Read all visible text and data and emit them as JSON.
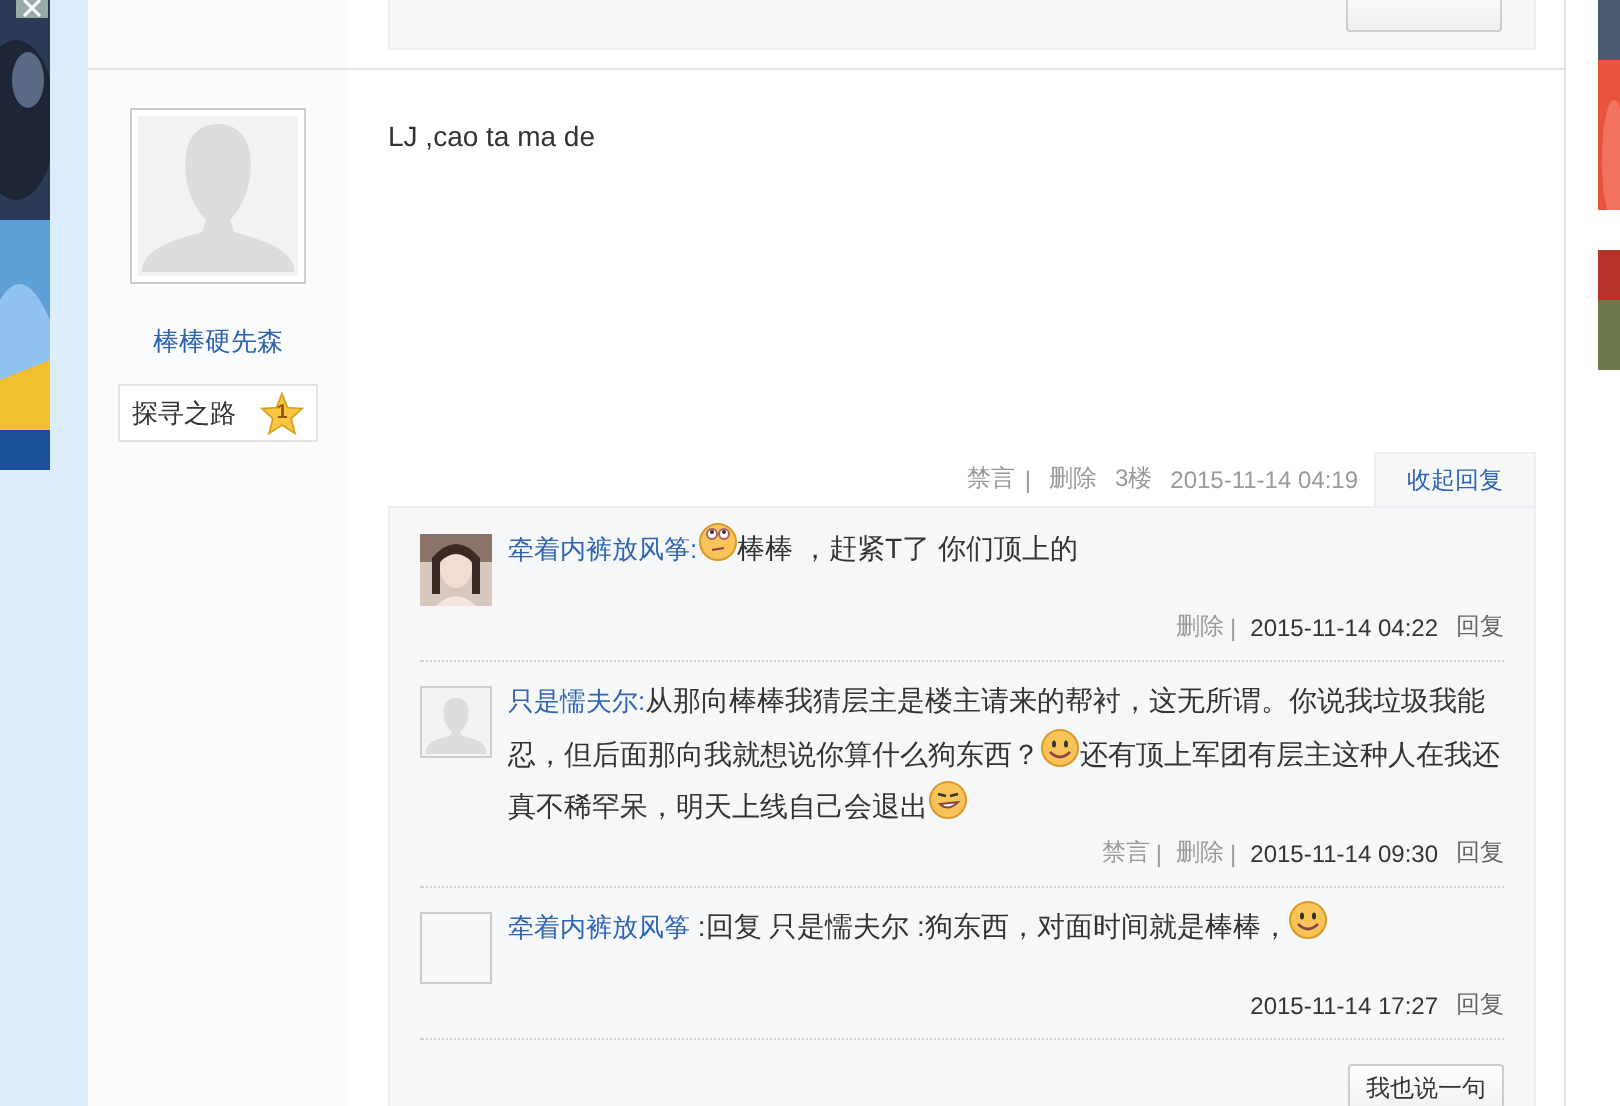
{
  "post": {
    "author": {
      "name": "棒棒硬先森",
      "badge": "探寻之路",
      "badge_level": "1"
    },
    "content": "LJ ,cao ta ma de",
    "footer": {
      "actions": [
        {
          "label": "禁言",
          "sep": "|"
        },
        {
          "label": "删除"
        }
      ],
      "floor": "3楼",
      "time": "2015-11-14 04:19",
      "toggle": "收起回复"
    },
    "replies": [
      {
        "avatar": {
          "kind": "picture"
        },
        "name": "牵着内裤放风筝:",
        "segments": [
          {
            "kind": "smirk"
          },
          {
            "kind": "text",
            "text": "棒棒 ，赶紧T了 你们顶上的"
          }
        ],
        "actions": [
          {
            "label": "删除",
            "sep": "|"
          }
        ],
        "time": "2015-11-14 04:22",
        "reply": "回复"
      },
      {
        "avatar": {
          "kind": "silhouette"
        },
        "name": "只是懦夫尔:",
        "segments": [
          {
            "kind": "text",
            "text": "从那向棒棒我猜层主是楼主请来的帮衬，这无所谓。你说我垃圾我能忍，但后面那向我就想说你算什么狗东西？"
          },
          {
            "kind": "smile"
          },
          {
            "kind": "text",
            "text": "还有顶上军团有层主这种人在我还真不稀罕呆，明天上线自己会退出"
          },
          {
            "kind": "grin"
          }
        ],
        "actions": [
          {
            "label": "禁言",
            "sep": "|"
          },
          {
            "label": "删除",
            "sep": "|"
          }
        ],
        "time": "2015-11-14 09:30",
        "reply": "回复"
      },
      {
        "avatar": {
          "kind": "blank"
        },
        "name": "牵着内裤放风筝",
        "segments": [
          {
            "kind": "text",
            "text": " :回复 只是懦夫尔 :狗东西，对面时间就是棒棒，"
          },
          {
            "kind": "smile"
          }
        ],
        "time": "2015-11-14 17:27",
        "reply": "回复"
      }
    ],
    "say_button": "我也说一句"
  }
}
